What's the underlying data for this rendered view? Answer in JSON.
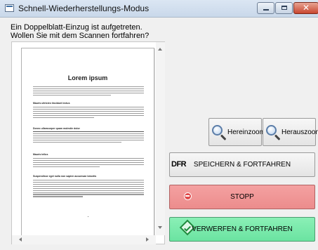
{
  "window": {
    "title": "Schnell-Wiederherstellungs-Modus"
  },
  "message": {
    "line1": "Ein Doppelblatt-Einzug ist aufgetreten.",
    "line2": "Wollen Sie mit dem Scannen fortfahren?"
  },
  "preview": {
    "page_title": "Lorem ipsum",
    "sections": [
      {
        "heading": ""
      },
      {
        "heading": "Mauris ultricies tincidunt lectus"
      },
      {
        "heading": "Donec ullamcorper quam molestie dolor"
      },
      {
        "heading": "Mauris tellus"
      },
      {
        "heading": "Suspendisse eget nulla non sapien accumsan lobortis"
      }
    ]
  },
  "buttons": {
    "zoom_in": "Hereinzoomen",
    "zoom_out": "Herauszoomen",
    "save_continue": "SPEICHERN & FORTFAHREN",
    "dfr_label": "DFR",
    "stop": "STOPP",
    "discard_continue": "VERWERFEN & FORTFAHREN"
  },
  "icons": {
    "zoom_in": "magnifier-plus-icon",
    "zoom_out": "magnifier-minus-icon",
    "stop": "stop-icon",
    "discard": "diamond-check-icon"
  },
  "colors": {
    "stop_button": "#ec8c8c",
    "discard_button": "#6be3a1",
    "close_button": "#c8462f"
  }
}
